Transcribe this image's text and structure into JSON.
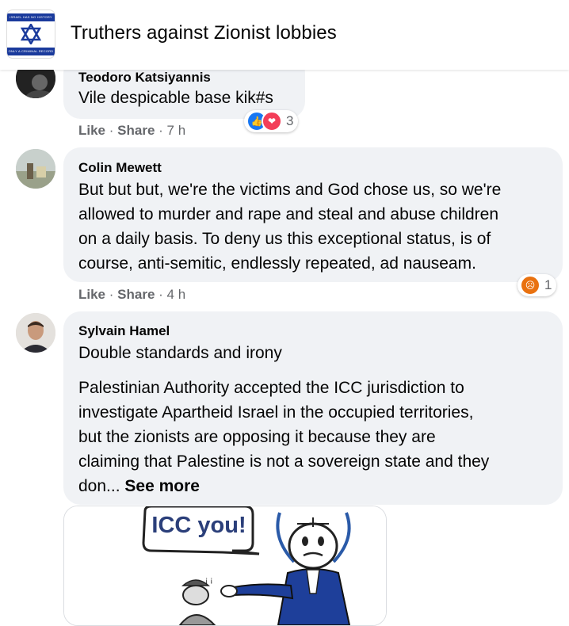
{
  "group": {
    "title": "Truthers against Zionist lobbies",
    "icon_band_top": "ISRAEL HAS NO HISTORY",
    "icon_band_bottom": "ONLY A CRIMINAL RECORD"
  },
  "comments": [
    {
      "author": "Teodoro Katsiyannis",
      "text": "Vile despicable base kik#s",
      "like_label": "Like",
      "share_label": "Share",
      "time": "7 h",
      "reactions": {
        "icons": [
          "like-icon",
          "love-icon"
        ],
        "count": "3"
      }
    },
    {
      "author": "Colin Mewett",
      "text_lines": [
        "But but but, we're the victims and God chose us, so we're",
        "allowed to murder and rape and steal and abuse children",
        "on a daily basis. To deny us this exceptional status, is of",
        "course, anti-semitic, endlessly repeated, ad nauseam."
      ],
      "like_label": "Like",
      "share_label": "Share",
      "time": "4 h",
      "reactions": {
        "icons": [
          "angry-icon"
        ],
        "count": "1"
      }
    },
    {
      "author": "Sylvain Hamel",
      "first_line": "Double standards and irony",
      "text_lines": [
        "Palestinian Authority accepted the ICC jurisdiction to",
        "investigate Apartheid Israel in the occupied territories,",
        "but the zionists are opposing it because they are",
        "claiming that Palestine is not a sovereign state and they"
      ],
      "last_line": "don...",
      "see_more": "See more",
      "image_caption": "ICC you!"
    }
  ],
  "colors": {
    "bubble": "#f0f2f5",
    "meta_text": "#65676b",
    "like_blue": "#1877f2",
    "love_red": "#f33e58",
    "angry_orange": "#e9710f"
  }
}
